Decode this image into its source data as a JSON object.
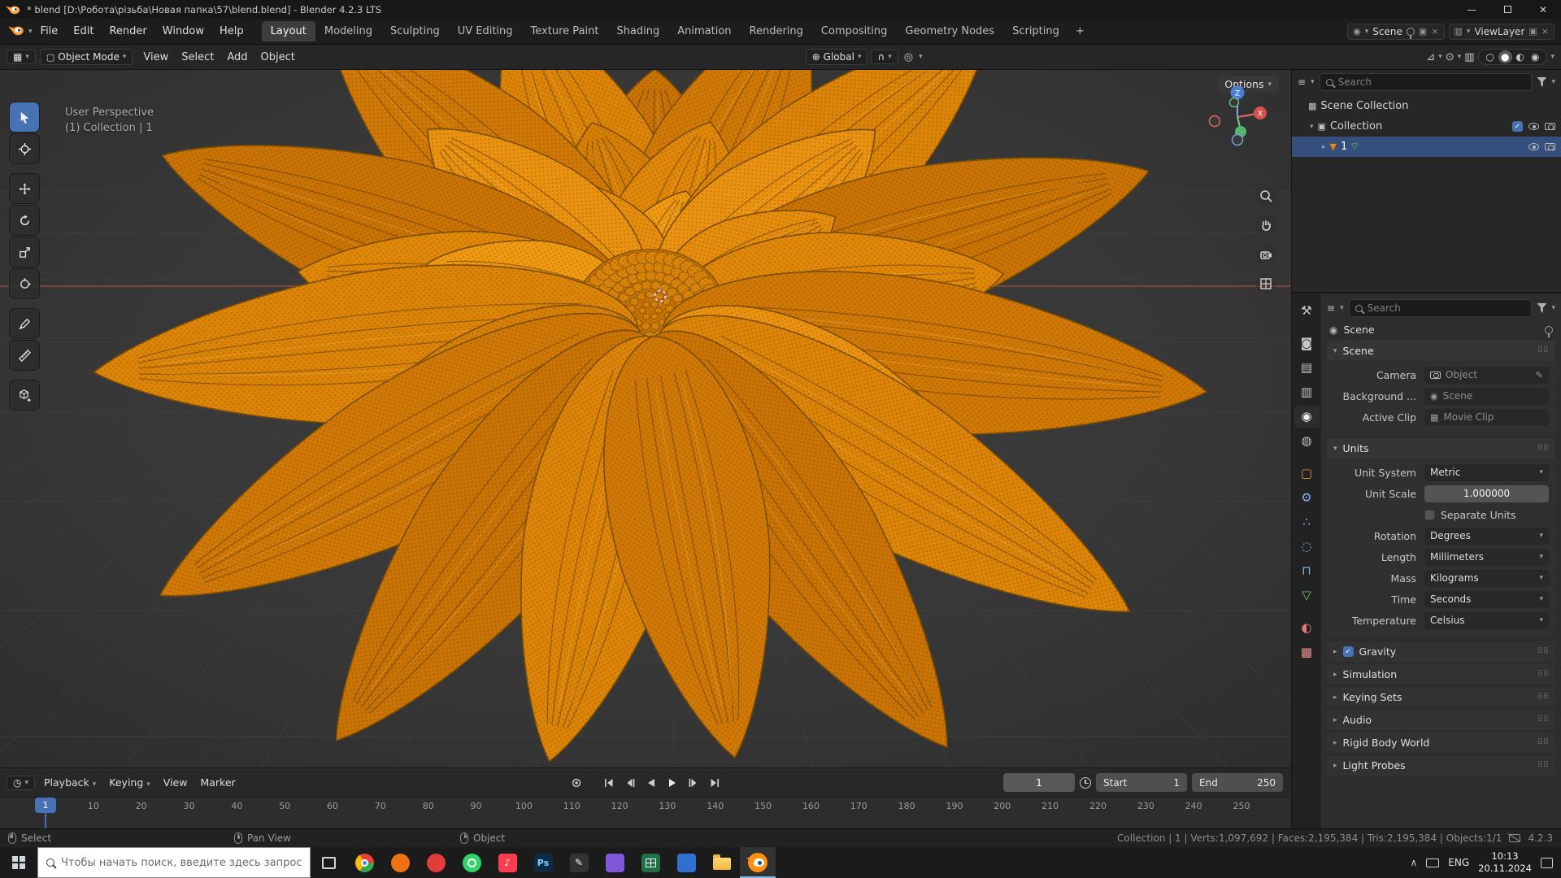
{
  "window": {
    "title": "* blend [D:\\Робота\\різьба\\Новая папка\\57\\blend.blend] - Blender 4.2.3 LTS"
  },
  "topbar": {
    "menus": [
      "File",
      "Edit",
      "Render",
      "Window",
      "Help"
    ],
    "workspaces": [
      "Layout",
      "Modeling",
      "Sculpting",
      "UV Editing",
      "Texture Paint",
      "Shading",
      "Animation",
      "Rendering",
      "Compositing",
      "Geometry Nodes",
      "Scripting"
    ],
    "active_workspace": "Layout",
    "new_tab": "+",
    "scene": "Scene",
    "viewlayer": "ViewLayer"
  },
  "header": {
    "mode": "Object Mode",
    "menus": [
      "View",
      "Select",
      "Add",
      "Object"
    ],
    "orientation": "Global",
    "options": "Options"
  },
  "toolbar": {
    "tools": [
      {
        "name": "select-box",
        "active": true
      },
      {
        "name": "cursor"
      },
      {
        "name": "move"
      },
      {
        "name": "rotate"
      },
      {
        "name": "scale"
      },
      {
        "name": "transform"
      },
      {
        "name": "annotate"
      },
      {
        "name": "measure"
      },
      {
        "name": "add-cube"
      }
    ]
  },
  "viewport": {
    "perspective": "User Perspective",
    "collection": "(1) Collection | 1",
    "gizmo_axes": {
      "x": "X",
      "z": "Z"
    }
  },
  "outliner": {
    "search_placeholder": "Search",
    "rows": [
      {
        "label": "Scene Collection",
        "depth": 0,
        "icon": "scene-collection"
      },
      {
        "label": "Collection",
        "depth": 1,
        "icon": "collection",
        "caret": "open",
        "checkbox": true,
        "eye": true,
        "camera": true
      },
      {
        "label": "1",
        "depth": 2,
        "icon": "mesh-object",
        "caret": "closed",
        "selected": true,
        "meshdata": true,
        "eye": true,
        "camera": true
      }
    ]
  },
  "properties": {
    "search_placeholder": "Search",
    "breadcrumb": "Scene",
    "tabs": [
      {
        "name": "tool",
        "color": "#c6c6c6"
      },
      {
        "name": "render",
        "color": "#c6c6c6"
      },
      {
        "name": "output",
        "color": "#c6c6c6"
      },
      {
        "name": "view-layer",
        "color": "#c6c6c6"
      },
      {
        "name": "scene",
        "color": "#ededed",
        "active": true
      },
      {
        "name": "world",
        "color": "#c6c6c6"
      },
      {
        "name": "object",
        "color": "#e8912c"
      },
      {
        "name": "modifiers",
        "color": "#7fb0e8"
      },
      {
        "name": "particles",
        "color": "#7fb0e8"
      },
      {
        "name": "physics",
        "color": "#7fb0e8"
      },
      {
        "name": "constraints",
        "color": "#7fb0e8"
      },
      {
        "name": "object-data",
        "color": "#66c069"
      },
      {
        "name": "material",
        "color": "#e07a7a"
      },
      {
        "name": "texture",
        "color": "#e58f8f"
      }
    ],
    "scene_panel": {
      "title": "Scene",
      "rows": [
        {
          "label": "Camera",
          "value": "Object",
          "icon": "camera",
          "eyedropper": true
        },
        {
          "label": "Background ...",
          "value": "Scene",
          "icon": "scene"
        },
        {
          "label": "Active Clip",
          "value": "Movie Clip",
          "icon": "clip"
        }
      ]
    },
    "units_panel": {
      "title": "Units",
      "rows": [
        {
          "label": "Unit System",
          "value": "Metric",
          "type": "dropdown"
        },
        {
          "label": "Unit Scale",
          "value": "1.000000",
          "type": "slider"
        },
        {
          "label": "",
          "value": "Separate Units",
          "type": "checkbox",
          "checked": false
        },
        {
          "label": "Rotation",
          "value": "Degrees",
          "type": "dropdown"
        },
        {
          "label": "Length",
          "value": "Millimeters",
          "type": "dropdown"
        },
        {
          "label": "Mass",
          "value": "Kilograms",
          "type": "dropdown"
        },
        {
          "label": "Time",
          "value": "Seconds",
          "type": "dropdown"
        },
        {
          "label": "Temperature",
          "value": "Celsius",
          "type": "dropdown"
        }
      ]
    },
    "collapsed_panels": [
      {
        "label": "Gravity",
        "checkbox": true,
        "checked": true
      },
      {
        "label": "Simulation"
      },
      {
        "label": "Keying Sets"
      },
      {
        "label": "Audio"
      },
      {
        "label": "Rigid Body World"
      },
      {
        "label": "Light Probes"
      }
    ]
  },
  "timeline": {
    "menus": [
      "Playback",
      "Keying",
      "View",
      "Marker"
    ],
    "current_frame": "1",
    "playhead": "1",
    "start_label": "Start",
    "start_value": "1",
    "end_label": "End",
    "end_value": "250",
    "ticks": [
      "1",
      "10",
      "20",
      "30",
      "40",
      "50",
      "60",
      "70",
      "80",
      "90",
      "100",
      "110",
      "120",
      "130",
      "140",
      "150",
      "160",
      "170",
      "180",
      "190",
      "200",
      "210",
      "220",
      "230",
      "240",
      "250"
    ]
  },
  "statusbar": {
    "hints": [
      {
        "icon": "mouse-left",
        "label": "Select"
      },
      {
        "icon": "mouse-middle",
        "label": "Pan View"
      },
      {
        "icon": "mouse-right",
        "label": "Object"
      }
    ],
    "stats": "Collection | 1 | Verts:1,097,692 | Faces:2,195,384 | Tris:2,195,384 | Objects:1/1",
    "version": "4.2.3"
  },
  "taskbar": {
    "search_placeholder": "Чтобы начать поиск, введите здесь запрос",
    "apps": [
      {
        "name": "task-view"
      },
      {
        "name": "chrome"
      },
      {
        "name": "app-orange"
      },
      {
        "name": "app-red"
      },
      {
        "name": "whatsapp"
      },
      {
        "name": "music"
      },
      {
        "name": "photoshop",
        "badge": "Ps"
      },
      {
        "name": "pen-app"
      },
      {
        "name": "app-purple"
      },
      {
        "name": "excel"
      },
      {
        "name": "app-blue"
      },
      {
        "name": "explorer"
      },
      {
        "name": "blender",
        "active": true
      }
    ],
    "tray_language": "ENG",
    "tray_time": "10:13",
    "tray_date": "20.11.2024"
  },
  "colors": {
    "accent": "#4772b3",
    "selection": "#e8890a"
  }
}
